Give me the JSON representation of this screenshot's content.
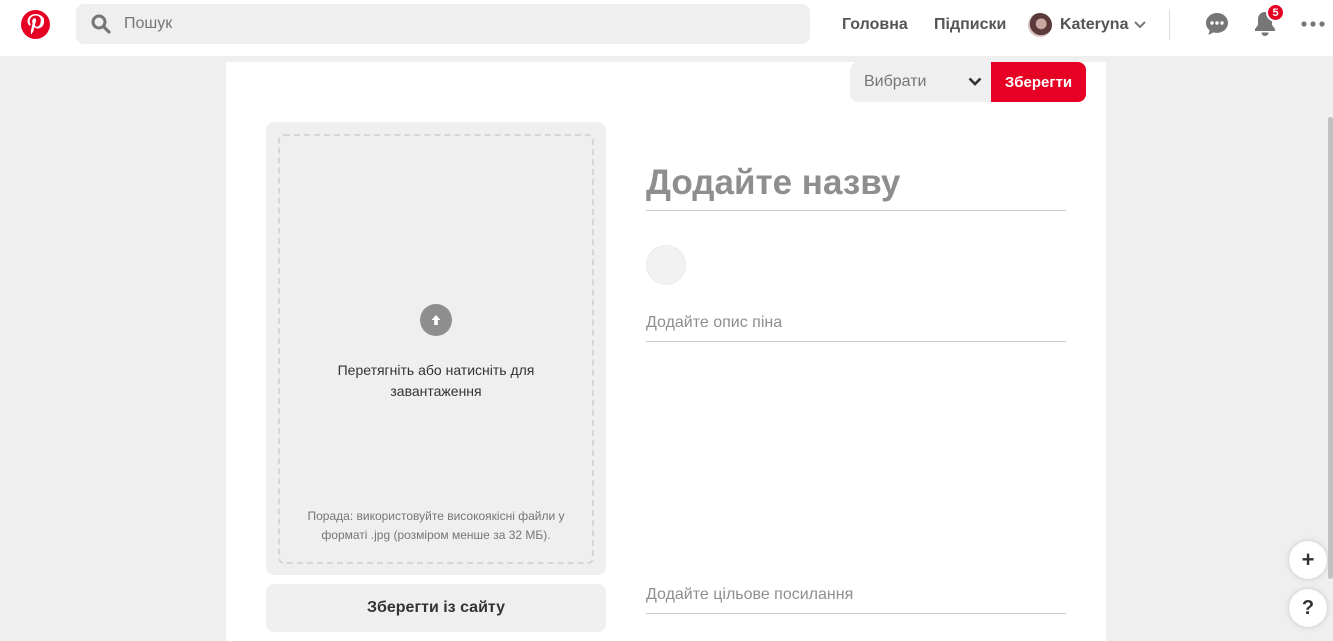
{
  "header": {
    "logo": "pinterest-logo",
    "search": {
      "placeholder": "Пошук",
      "value": ""
    },
    "nav": {
      "home": "Головна",
      "subscriptions": "Підписки"
    },
    "user": {
      "name": "Kateryna"
    },
    "notifications_count": "5",
    "icons": [
      "search-icon",
      "chevron-down-icon",
      "message-icon",
      "bell-icon",
      "more-icon"
    ]
  },
  "editor": {
    "board_select": {
      "label": "Вибрати"
    },
    "save_button": "Зберегти",
    "upload": {
      "instruction": "Перетягніть або натисніть для завантаження",
      "tip": "Порада: використовуйте високоякісні файли у форматі .jpg (розміром менше за 32 МБ)."
    },
    "save_from_site_button": "Зберегти із сайту",
    "title_placeholder": "Додайте назву",
    "description_placeholder": "Додайте опис піна",
    "link_placeholder": "Додайте цільове посилання"
  },
  "floating": {
    "add": "+",
    "help": "?"
  },
  "colors": {
    "brand": "#e60023",
    "panel": "#efefef"
  }
}
